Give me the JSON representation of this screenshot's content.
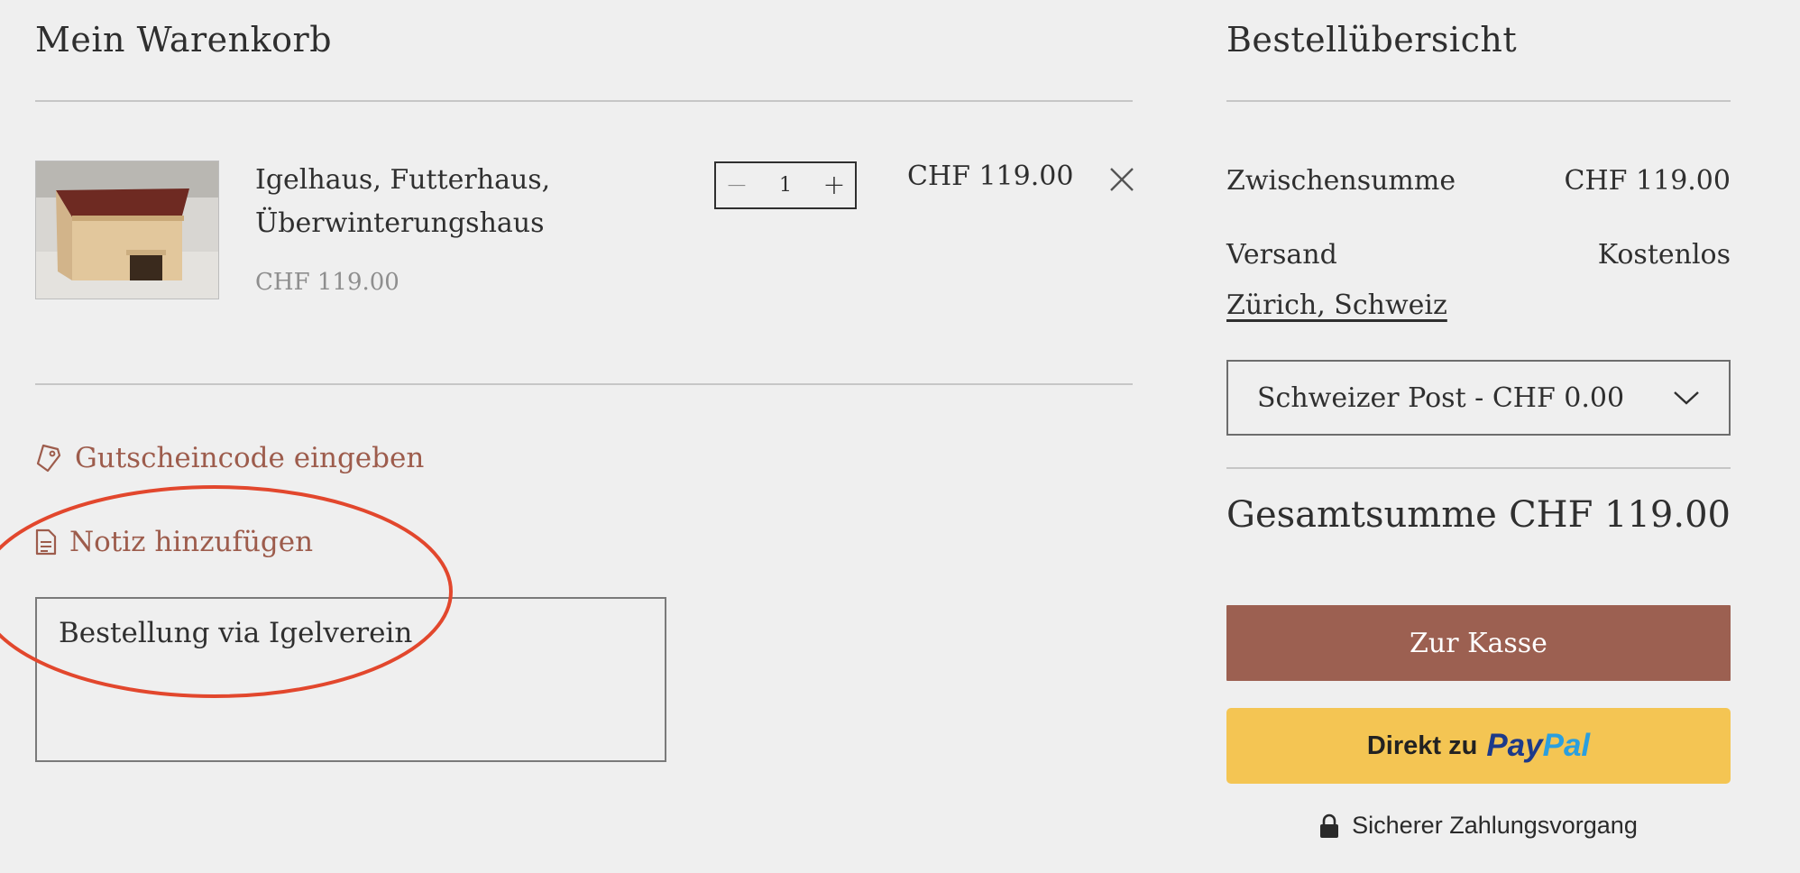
{
  "cart": {
    "title": "Mein Warenkorb",
    "item": {
      "name_line1": "Igelhaus, Futterhaus,",
      "name_line2": "Überwinterungshaus",
      "unit_price": "CHF 119.00",
      "quantity": "1",
      "line_total": "CHF 119.00",
      "decrement_symbol": "−",
      "increment_symbol": "+"
    },
    "coupon_link": "Gutscheincode eingeben",
    "note_link": "Notiz hinzufügen",
    "note_value": "Bestellung via Igelverein"
  },
  "summary": {
    "title": "Bestellübersicht",
    "subtotal_label": "Zwischensumme",
    "subtotal_value": "CHF 119.00",
    "shipping_label": "Versand",
    "shipping_value": "Kostenlos",
    "location": "Zürich, Schweiz",
    "shipping_option": "Schweizer Post - CHF 0.00",
    "total_label": "Gesamtsumme",
    "total_value": "CHF 119.00",
    "checkout_label": "Zur Kasse",
    "paypal_label": "Direkt zu",
    "paypal_brand_1": "Pay",
    "paypal_brand_2": "Pal",
    "secure_label": "Sicherer Zahlungsvorgang"
  },
  "icons": {
    "coupon": "tag-icon",
    "note": "document-icon",
    "remove": "close-icon",
    "dropdown": "chevron-down-icon",
    "secure": "lock-icon"
  },
  "colors": {
    "background": "#efefef",
    "accent": "#9c6051",
    "link": "#9d5c4c",
    "paypal_button": "#f4c553",
    "annotation": "#e2472d"
  }
}
